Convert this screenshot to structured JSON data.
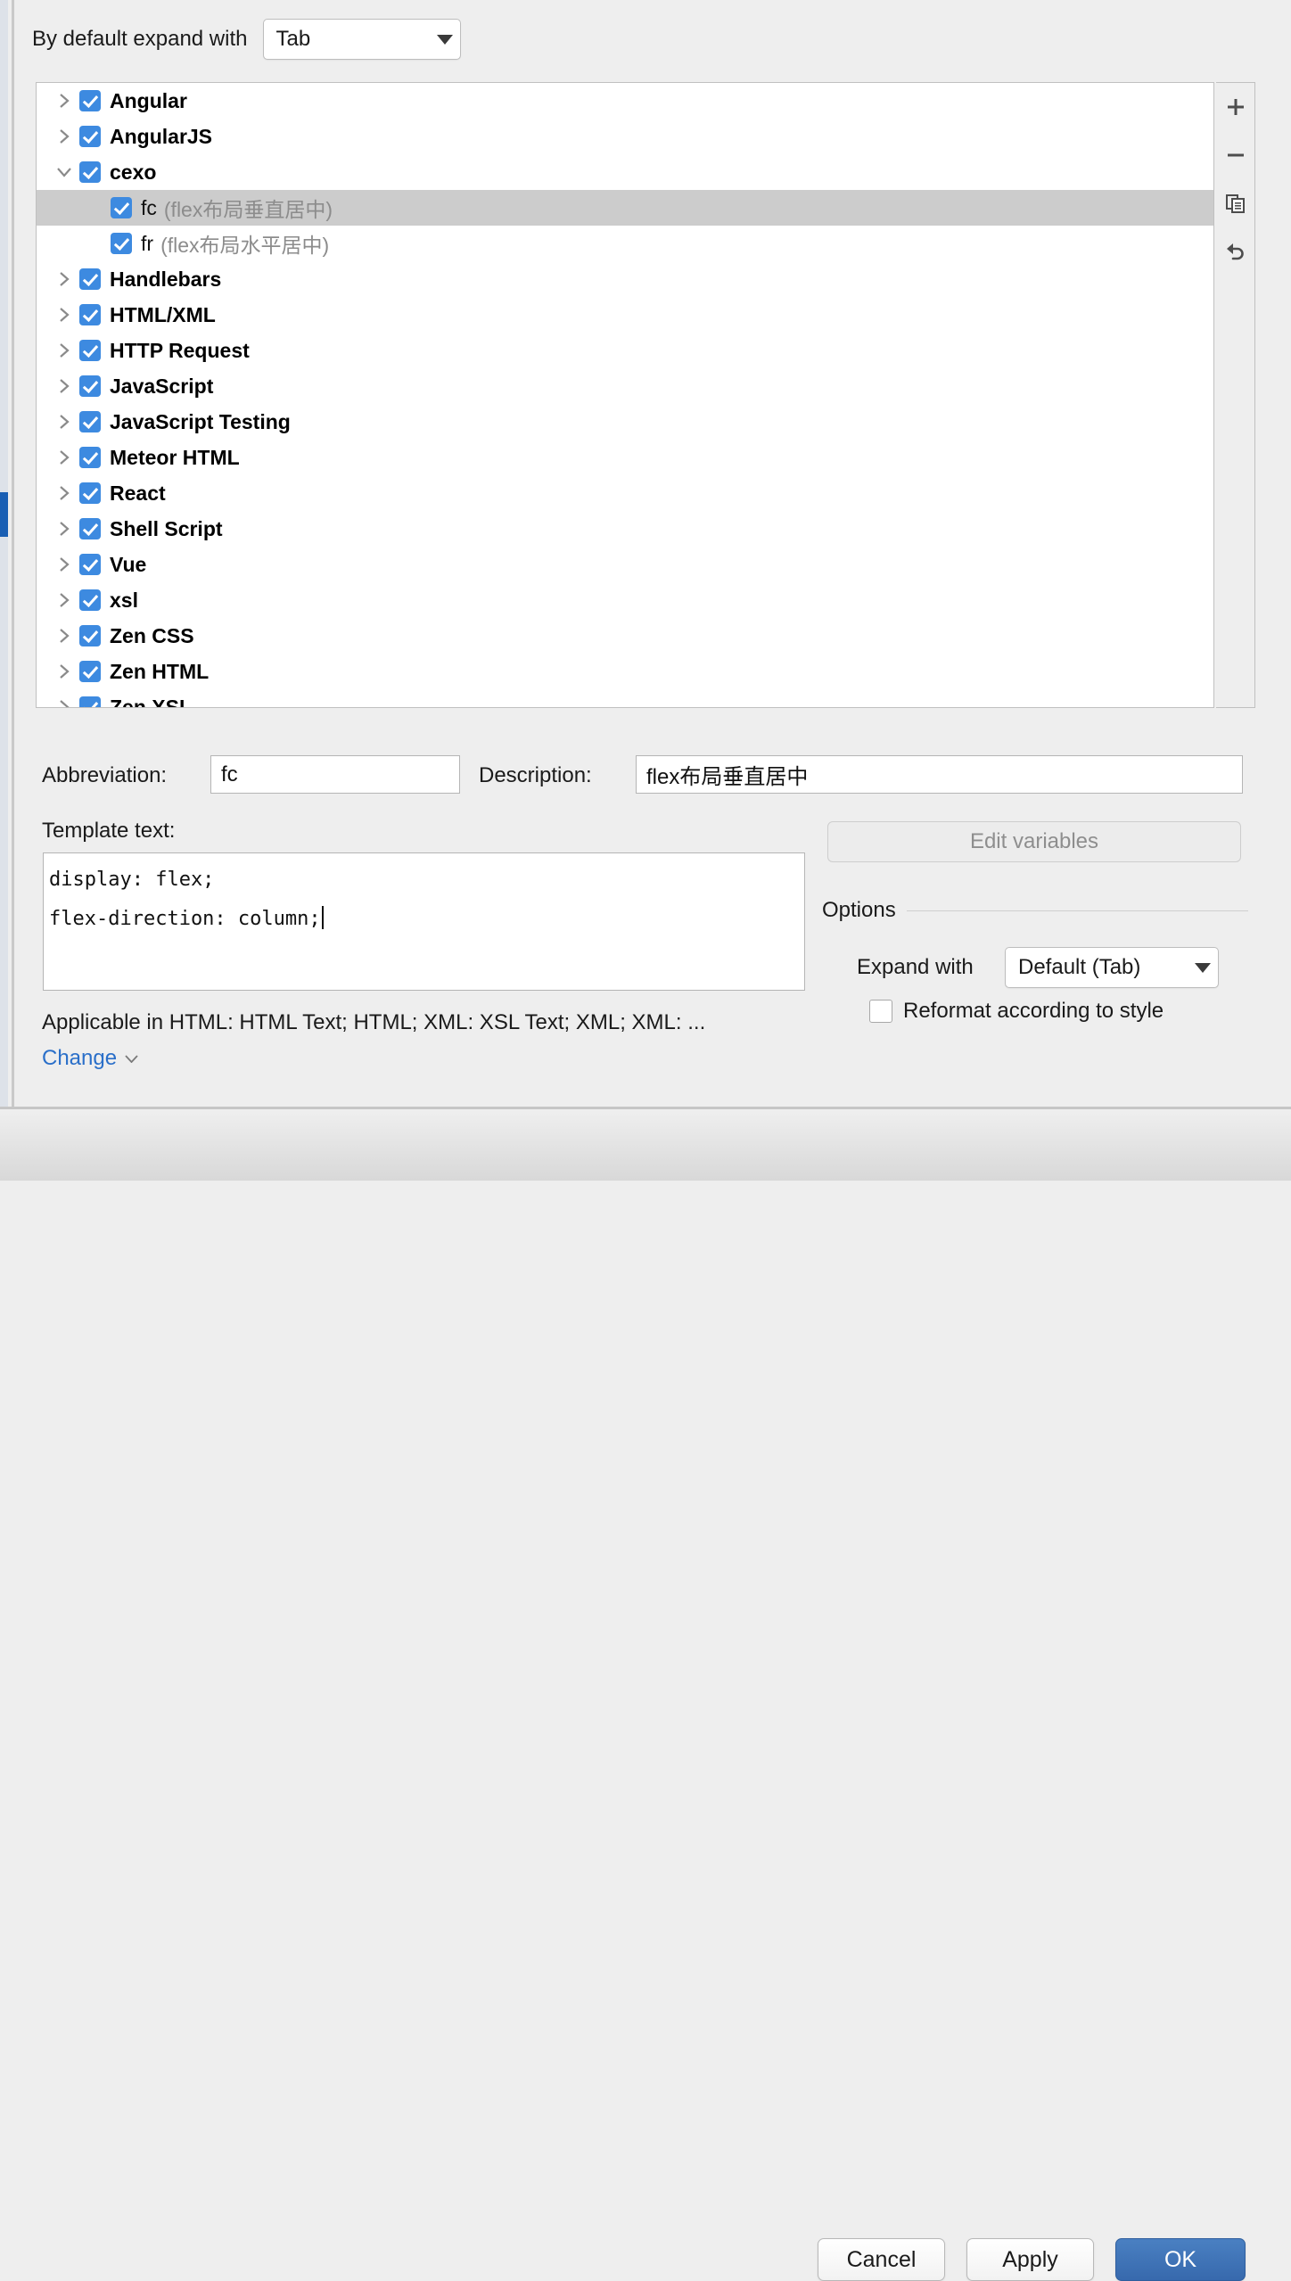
{
  "top": {
    "expand_label": "By default expand with",
    "expand_value": "Tab"
  },
  "tree": {
    "groups": [
      {
        "label": "Angular",
        "expanded": false,
        "checked": true
      },
      {
        "label": "AngularJS",
        "expanded": false,
        "checked": true
      },
      {
        "label": "cexo",
        "expanded": true,
        "checked": true
      },
      {
        "label": "Handlebars",
        "expanded": false,
        "checked": true
      },
      {
        "label": "HTML/XML",
        "expanded": false,
        "checked": true
      },
      {
        "label": "HTTP Request",
        "expanded": false,
        "checked": true
      },
      {
        "label": "JavaScript",
        "expanded": false,
        "checked": true
      },
      {
        "label": "JavaScript Testing",
        "expanded": false,
        "checked": true
      },
      {
        "label": "Meteor HTML",
        "expanded": false,
        "checked": true
      },
      {
        "label": "React",
        "expanded": false,
        "checked": true
      },
      {
        "label": "Shell Script",
        "expanded": false,
        "checked": true
      },
      {
        "label": "Vue",
        "expanded": false,
        "checked": true
      },
      {
        "label": "xsl",
        "expanded": false,
        "checked": true
      },
      {
        "label": "Zen CSS",
        "expanded": false,
        "checked": true
      },
      {
        "label": "Zen HTML",
        "expanded": false,
        "checked": true
      },
      {
        "label": "Zen XSL",
        "expanded": false,
        "checked": true
      }
    ],
    "children": {
      "cexo": [
        {
          "abbreviation": "fc",
          "description": "(flex布局垂直居中)",
          "checked": true,
          "selected": true
        },
        {
          "abbreviation": "fr",
          "description": "(flex布局水平居中)",
          "checked": true,
          "selected": false
        }
      ]
    },
    "toolbar": [
      {
        "name": "add-icon",
        "tooltip": "Add"
      },
      {
        "name": "remove-icon",
        "tooltip": "Remove"
      },
      {
        "name": "copy-icon",
        "tooltip": "Duplicate"
      },
      {
        "name": "revert-icon",
        "tooltip": "Revert"
      }
    ]
  },
  "form": {
    "abbreviation_label": "Abbreviation:",
    "abbreviation_value": "fc",
    "description_label": "Description:",
    "description_value": "flex布局垂直居中",
    "template_label": "Template text:",
    "template_line1": "display: flex;",
    "template_line2": "flex-direction: column;",
    "applicable_text": "Applicable in HTML: HTML Text; HTML; XML: XSL Text; XML; XML: ...",
    "change_link": "Change"
  },
  "options": {
    "edit_variables_label": "Edit variables",
    "title": "Options",
    "expand_with_label": "Expand with",
    "expand_with_value": "Default (Tab)",
    "reformat_label": "Reformat according to style",
    "reformat_checked": false
  },
  "footer": {
    "cancel_label": "Cancel",
    "apply_label": "Apply",
    "ok_label": "OK"
  },
  "colors": {
    "accent_blue": "#3769ad",
    "checkbox_blue": "#3d8ae0",
    "link_blue": "#2a6fc9",
    "selection_grey": "#cccccc",
    "scrollbar_blue": "#1a5fb4"
  }
}
